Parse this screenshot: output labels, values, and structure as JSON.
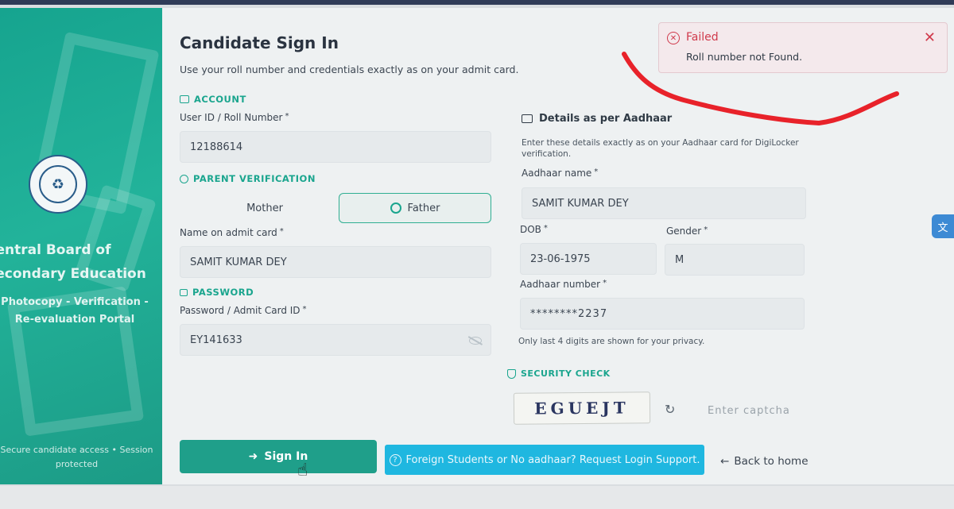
{
  "colors": {
    "accent": "#1aa58e",
    "error": "#d03a4c",
    "info_button": "#1fb7e0",
    "scribble": "#e8222a"
  },
  "sidebar": {
    "board_name": "Central Board of Secondary Education",
    "portal_name": "Photocopy - Verification - Re-evaluation Portal",
    "secure_note": "Secure candidate access • Session protected",
    "logo_icon": "cbse-emblem-icon"
  },
  "header": {
    "title": "Candidate Sign In",
    "subtitle": "Use your roll number and credentials exactly as on your admit card."
  },
  "account": {
    "section_label": "ACCOUNT",
    "user_id_label": "User ID / Roll Number",
    "user_id_value": "12188614"
  },
  "parent_verification": {
    "section_label": "PARENT VERIFICATION",
    "mother_label": "Mother",
    "father_label": "Father",
    "selected": "Father",
    "name_label": "Name on admit card",
    "name_value": "SAMIT KUMAR DEY"
  },
  "password": {
    "section_label": "PASSWORD",
    "field_label": "Password / Admit Card ID",
    "value": "EY141633"
  },
  "aadhaar": {
    "heading": "Details as per Aadhaar",
    "hint": "Enter these details exactly as on your Aadhaar card for DigiLocker verification.",
    "name_label": "Aadhaar name",
    "name_value": "SAMIT KUMAR DEY",
    "dob_label": "DOB",
    "dob_value": "23-06-1975",
    "gender_label": "Gender",
    "gender_value": "M",
    "number_label": "Aadhaar number",
    "number_value": "********2237",
    "privacy_note": "Only last 4 digits are shown for your privacy."
  },
  "security": {
    "section_label": "SECURITY CHECK",
    "captcha_text": "EGUEJT",
    "captcha_placeholder": "Enter captcha"
  },
  "actions": {
    "sign_in_label": "Sign In",
    "foreign_label": "Foreign Students or No aadhaar? Request Login Support.",
    "back_label": "Back to home"
  },
  "toast": {
    "title": "Failed",
    "message": "Roll number not Found."
  },
  "required_mark": "*"
}
